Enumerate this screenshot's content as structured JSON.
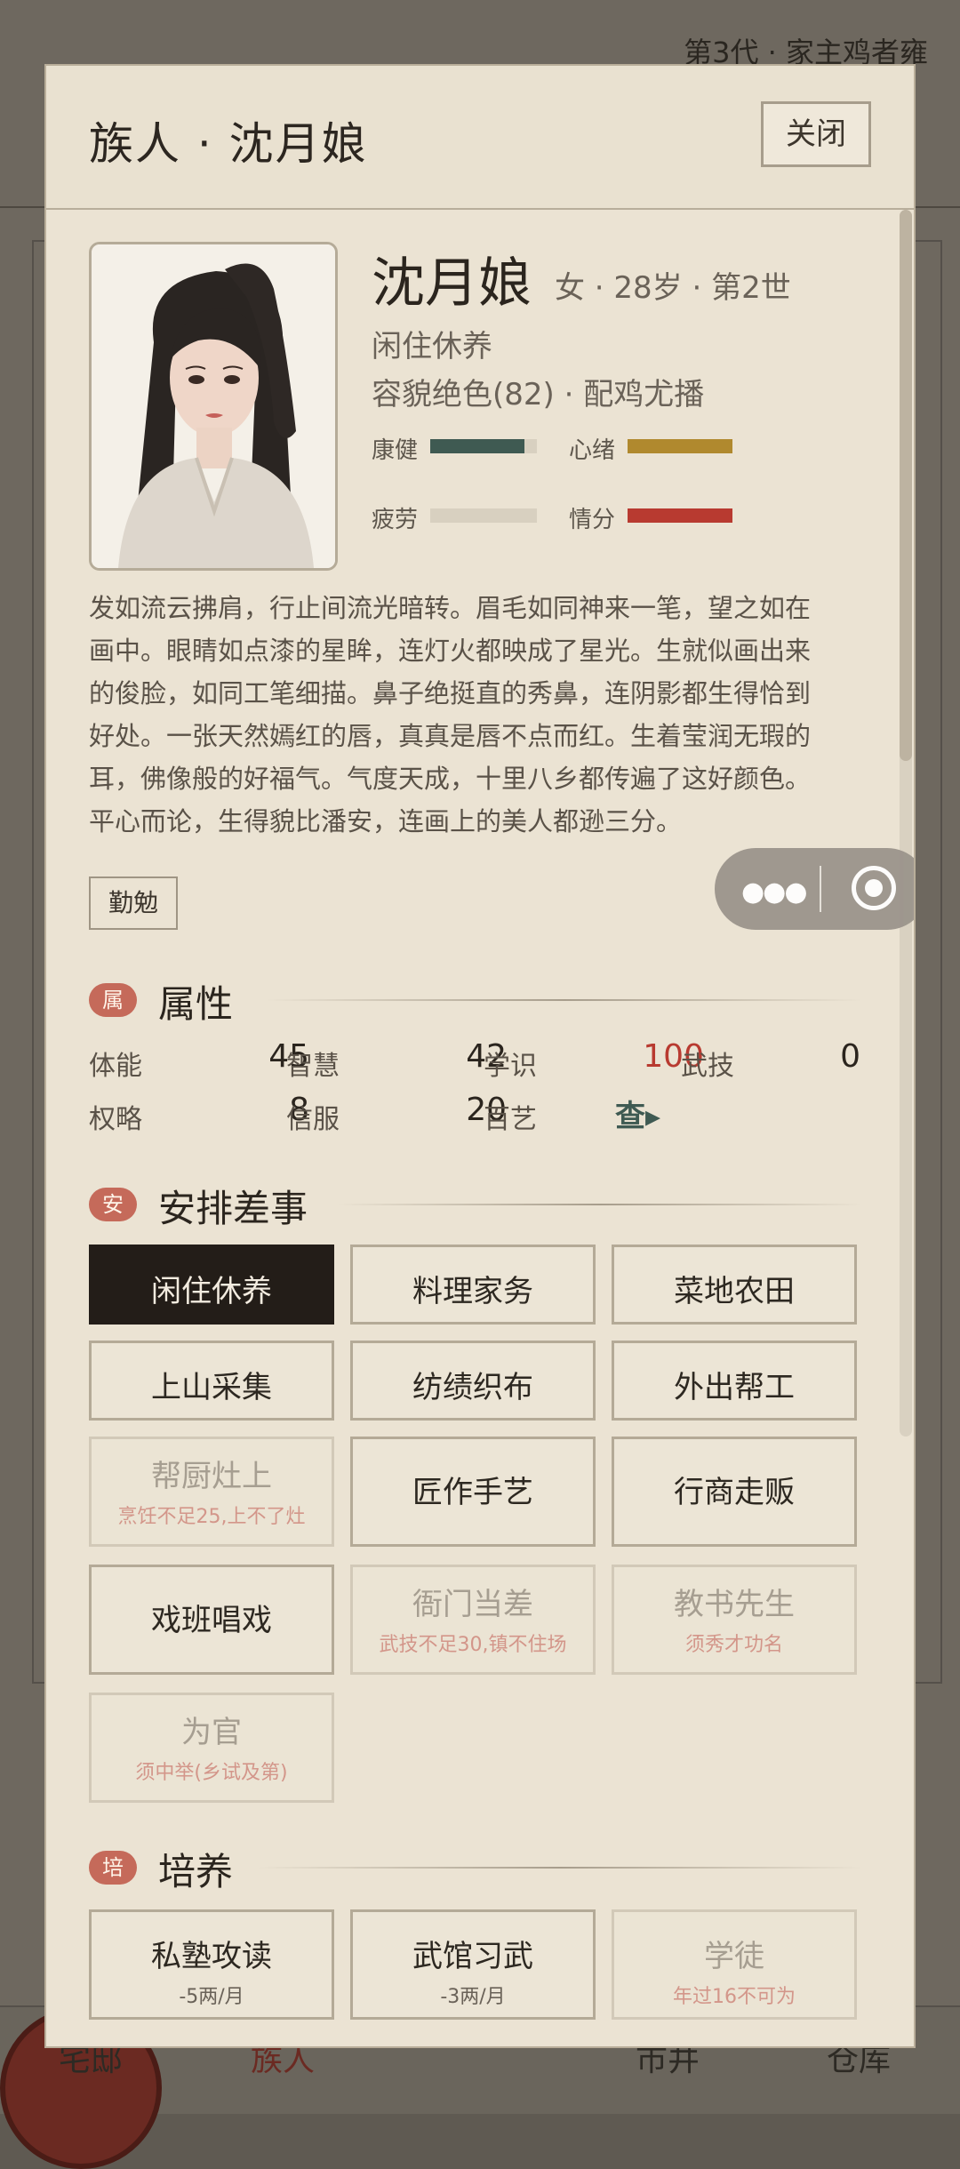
{
  "background": {
    "top_right": "第3代 · 家主鸡者雍",
    "nav": [
      "宅邸",
      "族人",
      "市井",
      "仓库"
    ]
  },
  "modal": {
    "title": "族人 · 沈月娘",
    "close_label": "关闭"
  },
  "profile": {
    "name": "沈月娘",
    "meta": "女 · 28岁 · 第2世",
    "status": "闲住休养",
    "looks": "容貌绝色(82) · 配鸡尤播",
    "bars": [
      {
        "label": "康健",
        "value": 0.88,
        "color": "#3f5a52"
      },
      {
        "label": "心绪",
        "value": 1.0,
        "color": "#b0892e"
      },
      {
        "label": "疲劳",
        "value": 0.0,
        "color": "#3f5a52"
      },
      {
        "label": "情分",
        "value": 1.0,
        "color": "#b83a30"
      }
    ]
  },
  "description": "发如流云拂肩，行止间流光暗转。眉毛如同神来一笔，望之如在画中。眼睛如点漆的星眸，连灯火都映成了星光。生就似画出来的俊脸，如同工笔细描。鼻子绝挺直的秀鼻，连阴影都生得恰到好处。一张天然嫣红的唇，真真是唇不点而红。生着莹润无瑕的耳，佛像般的好福气。气度天成，十里八乡都传遍了这好颜色。平心而论，生得貌比潘安，连画上的美人都逊三分。",
  "trait_tag": "勤勉",
  "sections": {
    "attributes": {
      "badge": "属",
      "title": "属性"
    },
    "jobs": {
      "badge": "安",
      "title": "安排差事"
    },
    "training": {
      "badge": "培",
      "title": "培养"
    }
  },
  "attributes": [
    {
      "label": "体能",
      "value": "45"
    },
    {
      "label": "智慧",
      "value": "42"
    },
    {
      "label": "学识",
      "value": "100"
    },
    {
      "label": "武技",
      "value": "0"
    },
    {
      "label": "权略",
      "value": "8"
    },
    {
      "label": "信服",
      "value": "20"
    },
    {
      "label": "百艺",
      "value": "查▸"
    }
  ],
  "colors": {
    "highlight": "#b83a30",
    "link": "#3f5a52"
  },
  "jobs": [
    {
      "label": "闲住休养"
    },
    {
      "label": "料理家务"
    },
    {
      "label": "菜地农田"
    },
    {
      "label": "上山采集"
    },
    {
      "label": "纺绩织布"
    },
    {
      "label": "外出帮工"
    },
    {
      "label": "帮厨灶上",
      "note": "烹饪不足25,上不了灶"
    },
    {
      "label": "匠作手艺"
    },
    {
      "label": "行商走贩"
    },
    {
      "label": "戏班唱戏"
    },
    {
      "label": "衙门当差",
      "note": "武技不足30,镇不住场"
    },
    {
      "label": "教书先生",
      "note": "须秀才功名"
    },
    {
      "label": "为官",
      "note": "须中举(乡试及第)"
    }
  ],
  "training": [
    {
      "label": "私塾攻读",
      "cost": "-5两/月"
    },
    {
      "label": "武馆习武",
      "cost": "-3两/月"
    },
    {
      "label": "学徒",
      "note": "年过16不可为"
    }
  ]
}
